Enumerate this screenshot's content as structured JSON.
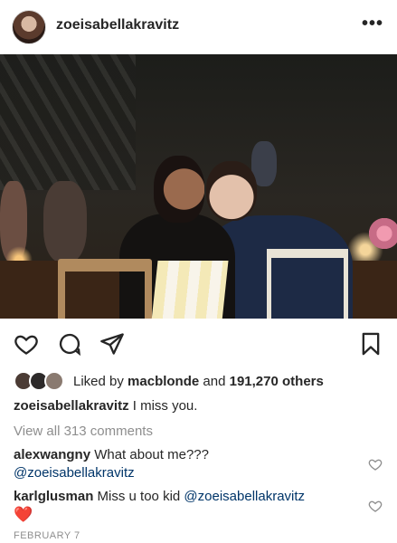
{
  "post": {
    "username": "zoeisabellakravitz",
    "more_icon": "more-horizontal-icon"
  },
  "actions": {
    "like_icon": "heart-outline-icon",
    "comment_icon": "comment-bubble-icon",
    "share_icon": "paper-plane-icon",
    "save_icon": "bookmark-icon"
  },
  "likes": {
    "prefix": "Liked by",
    "user": "macblonde",
    "joiner": "and",
    "others": "191,270 others"
  },
  "caption": {
    "username": "zoeisabellakravitz",
    "text": "I miss you."
  },
  "view_all_comments": "View all 313 comments",
  "comments": [
    {
      "username": "alexwangny",
      "text": "What about me???",
      "mention": "@zoeisabellakravitz"
    },
    {
      "username": "karlglusman",
      "text": "Miss u too kid",
      "mention": "@zoeisabellakravitz",
      "emoji": "❤️"
    }
  ],
  "date": "FEBRUARY 7",
  "colors": {
    "text": "#262626",
    "muted": "#8e8e8e",
    "mention": "#003569",
    "heart": "#ed4956"
  }
}
